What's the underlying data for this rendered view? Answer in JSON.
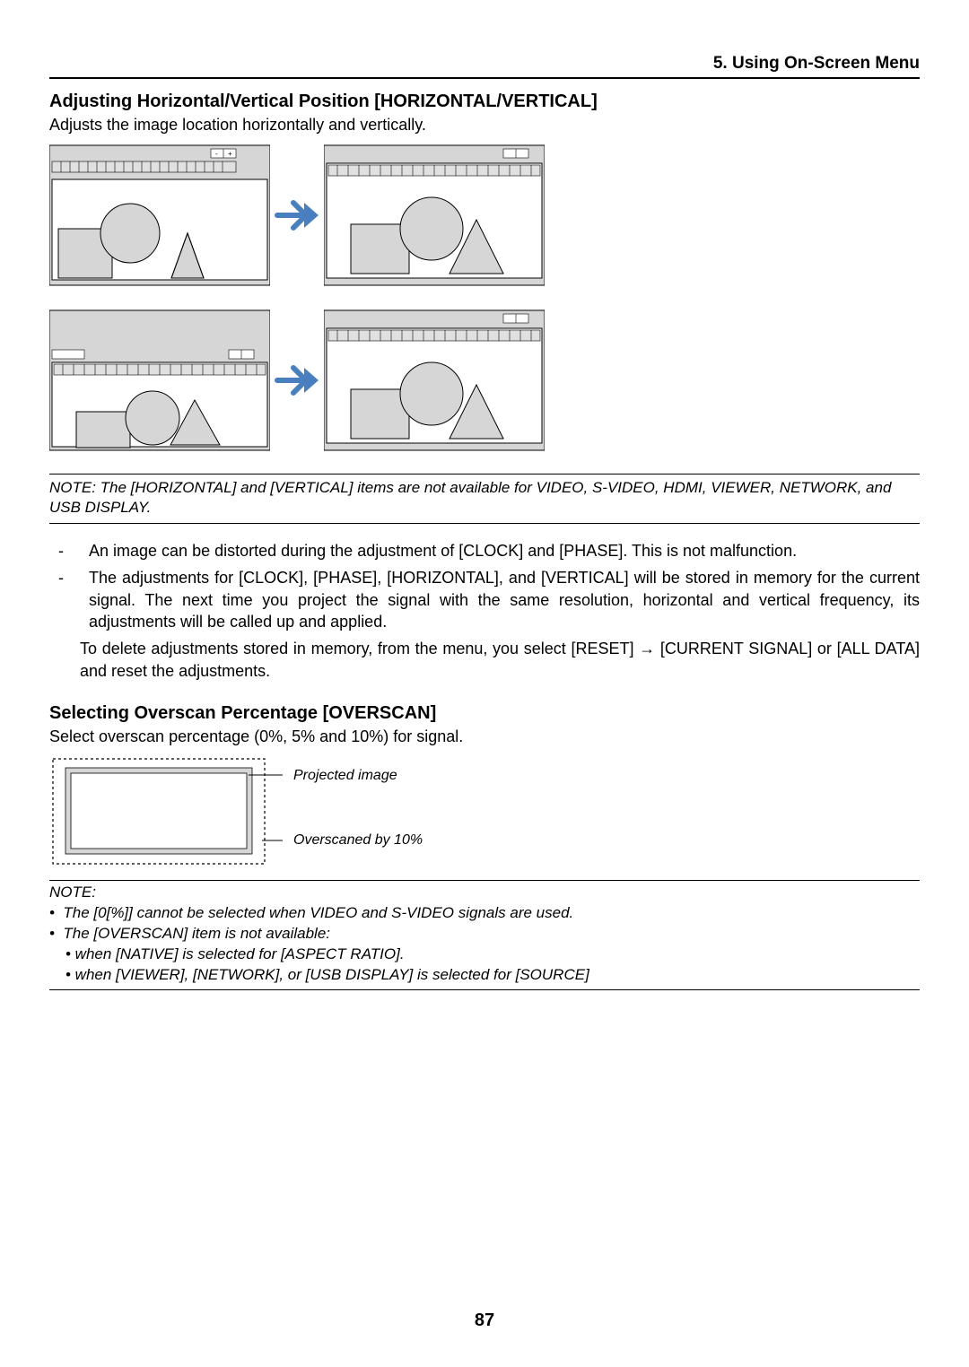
{
  "header": {
    "section_title": "5. Using On-Screen Menu"
  },
  "section1": {
    "title": "Adjusting Horizontal/Vertical Position [HORIZONTAL/VERTICAL]",
    "intro": "Adjusts the image location horizontally and vertically."
  },
  "note1": "NOTE: The [HORIZONTAL] and [VERTICAL] items are not available for VIDEO, S-VIDEO, HDMI, VIEWER, NETWORK, and USB DISPLAY.",
  "bullets": {
    "b1": "An image can be distorted during the adjustment of [CLOCK] and [PHASE]. This is not malfunction.",
    "b2": "The adjustments for [CLOCK], [PHASE], [HORIZONTAL], and [VERTICAL] will be stored in memory for the current signal. The next time you project the signal with the same resolution, horizontal and vertical frequency, its adjustments will be called up and applied.",
    "b2_sub": "To delete adjustments stored in memory, from the menu, you select [RESET] → [CURRENT SIGNAL] or [ALL DATA] and reset the adjustments."
  },
  "section2": {
    "title": "Selecting Overscan Percentage [OVERSCAN]",
    "intro": "Select overscan percentage (0%, 5% and 10%) for signal.",
    "label_projected": "Projected image",
    "label_overscanned": "Overscaned by 10%"
  },
  "note2": {
    "head": "NOTE:",
    "l1": "•  The [0[%]] cannot be selected when VIDEO and S-VIDEO signals are used.",
    "l2": "•  The [OVERSCAN] item is not available:",
    "l2a": "• when [NATIVE] is selected for [ASPECT RATIO].",
    "l2b": "• when [VIEWER], [NETWORK], or [USB DISPLAY] is selected for [SOURCE]"
  },
  "page_number": "87"
}
